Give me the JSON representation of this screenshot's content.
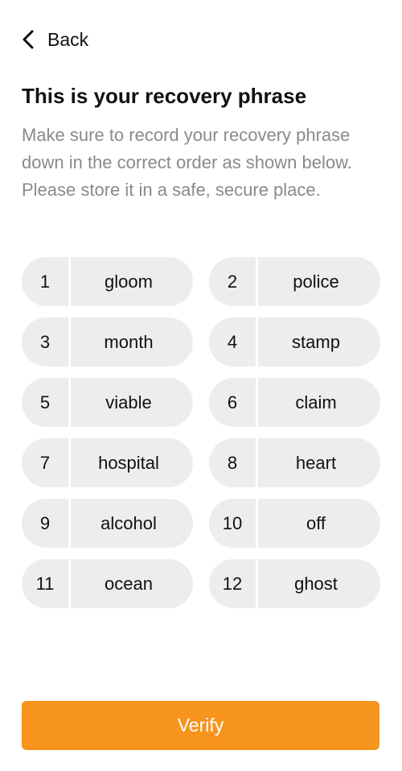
{
  "header": {
    "back_label": "Back",
    "back_icon": "chevron-left-icon"
  },
  "title": "This is your recovery phrase",
  "subtitle": "Make sure to record your recovery phrase down in the correct order as shown below. Please store it in a safe, secure place.",
  "phrase": [
    {
      "num": "1",
      "word": "gloom"
    },
    {
      "num": "2",
      "word": "police"
    },
    {
      "num": "3",
      "word": "month"
    },
    {
      "num": "4",
      "word": "stamp"
    },
    {
      "num": "5",
      "word": "viable"
    },
    {
      "num": "6",
      "word": "claim"
    },
    {
      "num": "7",
      "word": "hospital"
    },
    {
      "num": "8",
      "word": "heart"
    },
    {
      "num": "9",
      "word": "alcohol"
    },
    {
      "num": "10",
      "word": "off"
    },
    {
      "num": "11",
      "word": "ocean"
    },
    {
      "num": "12",
      "word": "ghost"
    }
  ],
  "verify_label": "Verify",
  "colors": {
    "accent": "#f7941d",
    "chip_background": "#ededed",
    "subtitle_text": "#8a8a8a"
  }
}
